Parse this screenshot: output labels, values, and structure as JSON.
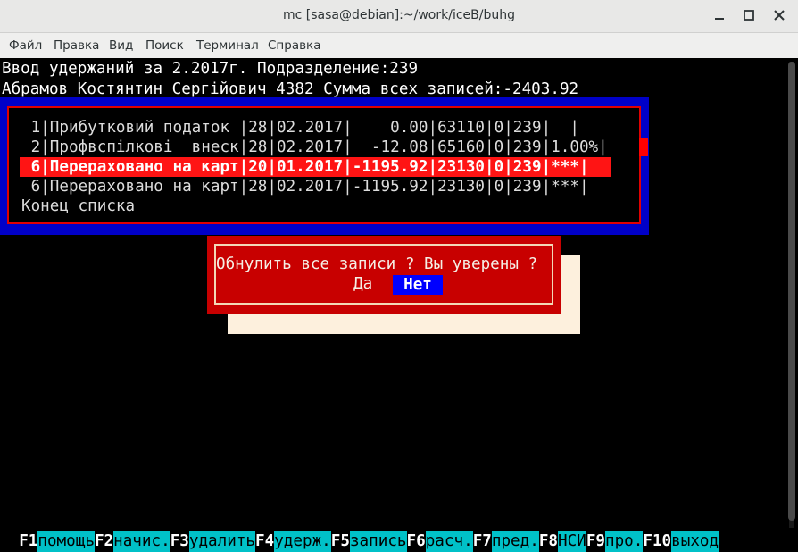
{
  "window": {
    "title": "mc [sasa@debian]:~/work/iceB/buhg",
    "menu": [
      "Файл",
      "Правка",
      "Вид",
      "Поиск",
      "Терминал",
      "Справка"
    ]
  },
  "header": {
    "line1": "Ввод удержаний за 2.2017г. Подразделение:239",
    "line2": "Абрамов Костянтин Сергійович 4382 Сумма всех записей:-2403.92"
  },
  "list": {
    "rows": [
      " 1|Прибутковий податок |28|02.2017|    0.00|63110|0|239|  |",
      " 2|Профвспілкові  внеск|28|02.2017|  -12.08|65160|0|239|1.00%|",
      " 6|Перераховано на карт|20|01.2017|-1195.92|23130|0|239|***|",
      " 6|Перераховано на карт|28|02.2017|-1195.92|23130|0|239|***|"
    ],
    "end_text": "Конец списка"
  },
  "dialog": {
    "message": "Обнулить все записи ? Вы уверены ?",
    "yes": "Да",
    "no": "Нет"
  },
  "fkeys": [
    {
      "key": "F1",
      "label": "помощь"
    },
    {
      "key": "F2",
      "label": "начис."
    },
    {
      "key": "F3",
      "label": "удалить"
    },
    {
      "key": "F4",
      "label": "удерж."
    },
    {
      "key": "F5",
      "label": "запись"
    },
    {
      "key": "F6",
      "label": "расч."
    },
    {
      "key": "F7",
      "label": "пред."
    },
    {
      "key": "F8",
      "label": "НСИ"
    },
    {
      "key": "F9",
      "label": "про."
    },
    {
      "key": "F10",
      "label": "выход"
    }
  ],
  "colors": {
    "panel_bg": "#0000c8",
    "panel_border": "#e00000",
    "selected_row": "#ff1414",
    "dialog_bg": "#c80000",
    "fkey_label_bg": "#00c1c8"
  }
}
